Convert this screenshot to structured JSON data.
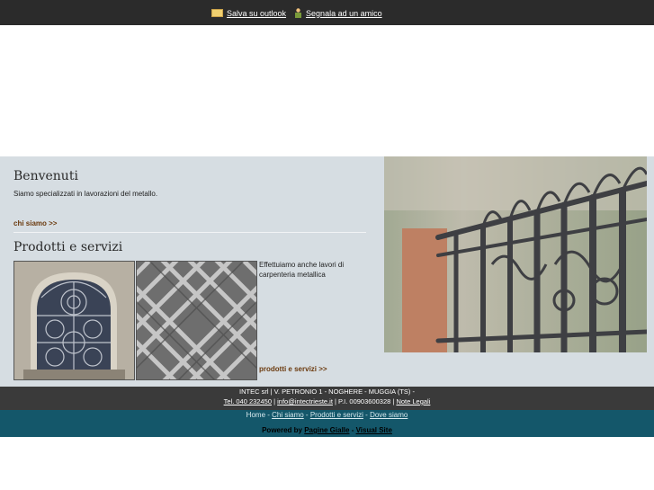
{
  "topbar": {
    "outlook_label": " Salva su outlook",
    "friend_label": " Segnala ad un amico"
  },
  "welcome": {
    "title": "Benvenuti",
    "text": "Siamo specializzati in lavorazioni del metallo.",
    "link": "chi siamo >>"
  },
  "products": {
    "title": "Prodotti e servizi",
    "description": "Effettuiamo anche lavori di carpenteria metallica",
    "link": "prodotti e servizi >>"
  },
  "footer": {
    "company_line": "INTEC srl | V. PETRONIO 1 - NOGHERE - MUGGIA (TS) -",
    "phone": "Tel. 040 232450",
    "sep1": " | ",
    "email": "info@intectrieste.it",
    "vat": " | P.I. 00903600328 | ",
    "legal": "Note Legali"
  },
  "nav": {
    "home": "Home",
    "sep": " - ",
    "about": "Chi siamo",
    "products": "Prodotti e servizi",
    "location": "Dove siamo"
  },
  "powered": {
    "label": "Powered by ",
    "pagine": "Pagine Gialle",
    "dash": " - ",
    "visual": "Visual Site"
  },
  "colors": {
    "topbar": "#2b2b2b",
    "content_bg": "#d6dde2",
    "link_brown": "#6b3a0e",
    "footer_dark": "#3a3a3a",
    "footer_teal": "#14576a"
  },
  "icons": [
    "outlook-icon",
    "friend-icon"
  ]
}
